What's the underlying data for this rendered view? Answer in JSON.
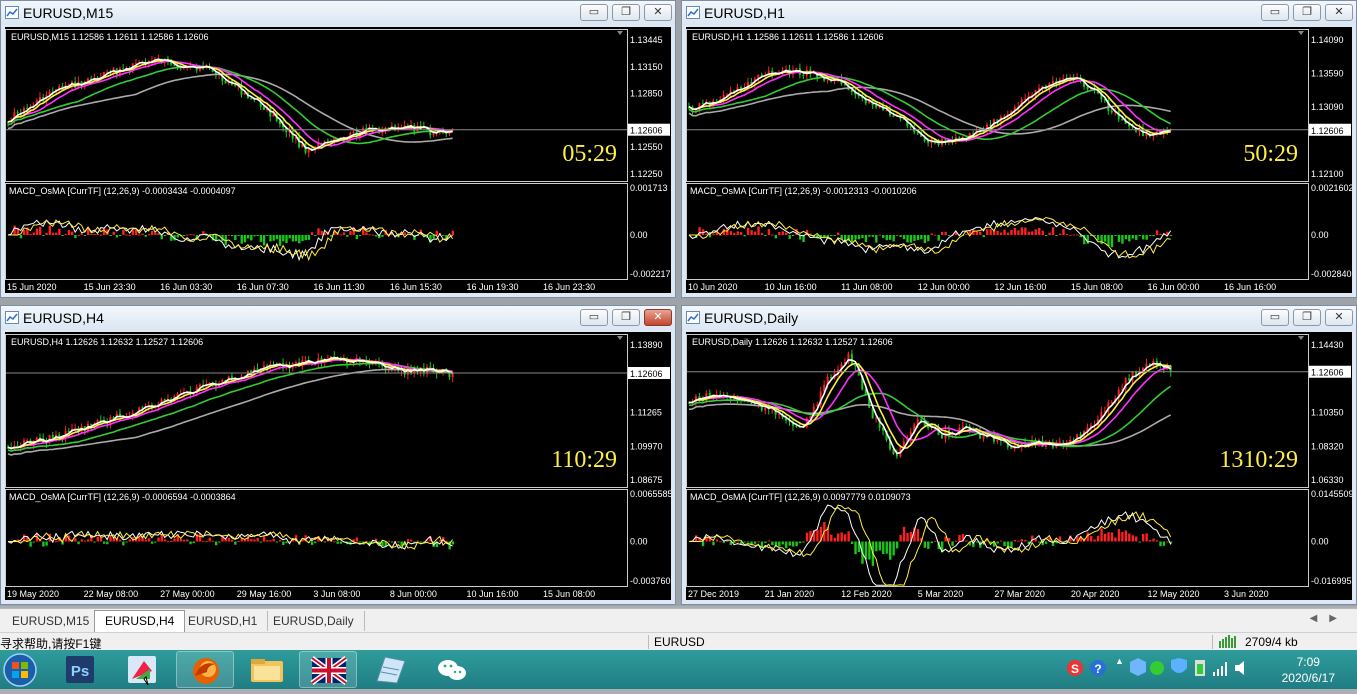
{
  "windows": [
    {
      "id": "m15",
      "title": "EURUSD,M15",
      "info": "EURUSD,M15  1.12586 1.12611 1.12586 1.12606",
      "price_labels": [
        "1.13445",
        "1.13150",
        "1.12850",
        "1.12606",
        "1.12550",
        "1.12250"
      ],
      "current_price": "1.12606",
      "countdown": "05:29",
      "macd_label": "MACD_OsMA [CurrTF] (12,26,9) -0.0003434 -0.0004097",
      "macd_scale": [
        "0.001713",
        "0.00",
        "-0.002217"
      ],
      "dates": [
        "15 Jun 2020",
        "15 Jun 23:30",
        "16 Jun 03:30",
        "16 Jun 07:30",
        "16 Jun 11:30",
        "16 Jun 15:30",
        "16 Jun 19:30",
        "16 Jun 23:30"
      ],
      "active": false
    },
    {
      "id": "h1",
      "title": "EURUSD,H1",
      "info": "EURUSD,H1  1.12586 1.12611 1.12586 1.12606",
      "price_labels": [
        "1.14090",
        "1.13590",
        "1.13090",
        "1.12606",
        "1.12100"
      ],
      "current_price": "1.12606",
      "countdown": "50:29",
      "macd_label": "MACD_OsMA [CurrTF] (12,26,9) -0.0012313 -0.0010206",
      "macd_scale": [
        "0.0021602",
        "0.00",
        "-0.002840"
      ],
      "dates": [
        "10 Jun 2020",
        "10 Jun 16:00",
        "11 Jun 08:00",
        "12 Jun 00:00",
        "12 Jun 16:00",
        "15 Jun 08:00",
        "16 Jun 00:00",
        "16 Jun 16:00"
      ],
      "active": false
    },
    {
      "id": "h4",
      "title": "EURUSD,H4",
      "info": "EURUSD,H4  1.12626 1.12632 1.12527 1.12606",
      "price_labels": [
        "1.13890",
        "1.12606",
        "1.11265",
        "1.09970",
        "1.08675"
      ],
      "current_price": "1.12606",
      "countdown": "110:29",
      "macd_label": "MACD_OsMA [CurrTF] (12,26,9) -0.0006594 -0.0003864",
      "macd_scale": [
        "0.0065585",
        "0.00",
        "-0.003760"
      ],
      "dates": [
        "19 May 2020",
        "22 May 08:00",
        "27 May 00:00",
        "29 May 16:00",
        "3 Jun 08:00",
        "8 Jun 00:00",
        "10 Jun 16:00",
        "15 Jun 08:00"
      ],
      "active": true
    },
    {
      "id": "d1",
      "title": "EURUSD,Daily",
      "info": "EURUSD,Daily  1.12626 1.12632 1.12527 1.12606",
      "price_labels": [
        "1.14430",
        "1.12606",
        "1.10350",
        "1.08320",
        "1.06330"
      ],
      "current_price": "1.12606",
      "countdown": "1310:29",
      "macd_label": "MACD_OsMA [CurrTF] (12,26,9) 0.0097779 0.0109073",
      "macd_scale": [
        "0.0145509",
        "0.00",
        "-0.016995"
      ],
      "dates": [
        "27 Dec 2019",
        "21 Jan 2020",
        "12 Feb 2020",
        "5 Mar 2020",
        "27 Mar 2020",
        "20 Apr 2020",
        "12 May 2020",
        "3 Jun 2020"
      ],
      "active": false
    }
  ],
  "tabs": [
    "EURUSD,M15",
    "EURUSD,H4",
    "EURUSD,H1",
    "EURUSD,Daily"
  ],
  "active_tab": "EURUSD,H4",
  "status": {
    "help": "寻求帮助,请按F1键",
    "symbol": "EURUSD",
    "traffic": "2709/4 kb"
  },
  "window_buttons": {
    "minimize": "▭",
    "restore": "❐",
    "close": "✕"
  },
  "taskbar": {
    "time": "7:09",
    "date": "2020/6/17",
    "apps": [
      "start-orb",
      "photoshop-icon",
      "paint-icon",
      "firefox-icon",
      "file-explorer-icon",
      "uk-flag-icon",
      "notepad-icon",
      "wechat-icon"
    ]
  },
  "colors": {
    "bull": "#ff2020",
    "bear": "#18c818",
    "ma_fast": "#ffffff",
    "ma_yellow": "#ffee44",
    "ma_magenta": "#ff30ff",
    "ma_green": "#33cc33",
    "ma_gray": "#aaaaaa",
    "countdown": "#ffee44"
  }
}
